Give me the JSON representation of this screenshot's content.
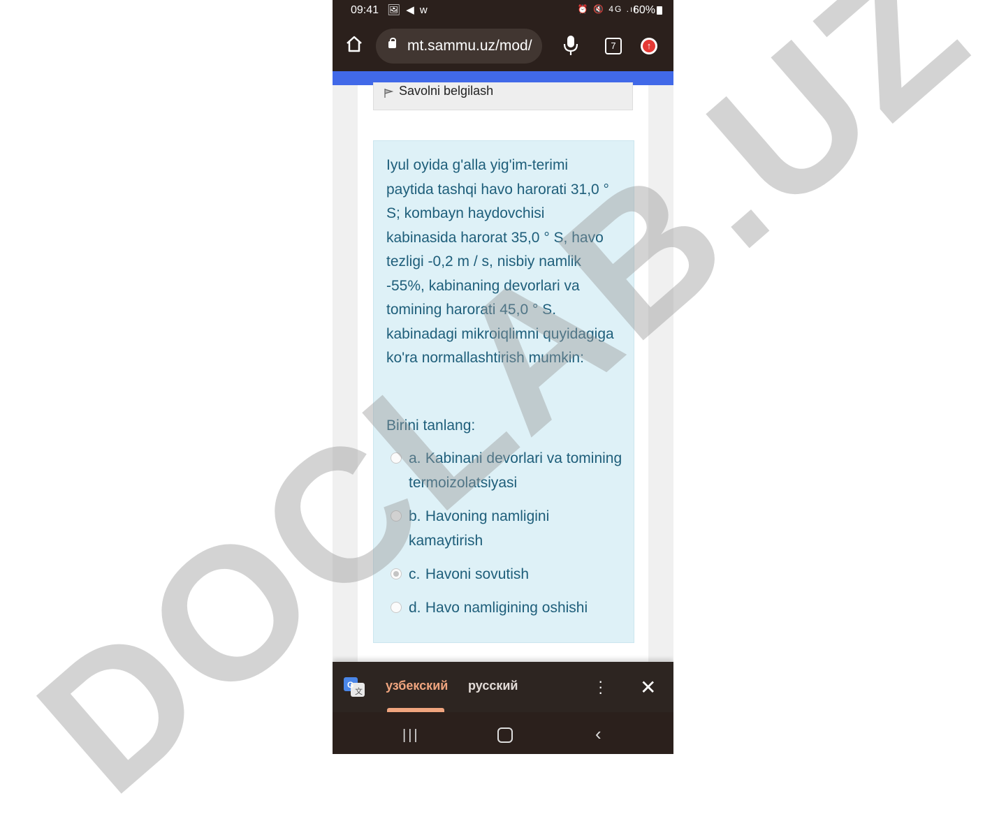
{
  "statusbar": {
    "time": "09:41",
    "left_icons": "🖼 ◀ w",
    "right_icons": "⏰ 🔇 4G .ıl",
    "battery": "60%"
  },
  "browser": {
    "url": "mt.sammu.uz/mod/",
    "tab_count": "7"
  },
  "page": {
    "flag_label": "Savolni belgilash",
    "question": "Iyul oyida g'alla yig'im-terimi paytida tashqi havo harorati 31,0 ° S; kombayn haydovchisi kabinasida harorat 35,0 ° S, havo tezligi -0,2 m / s, nisbiy namlik -55%, kabinaning devorlari va tomining harorati 45,0 ° S. kabinadagi mikroiqlimni quyidagiga ko'ra normallashtirish mumkin:",
    "prompt": "Birini tanlang:",
    "options": [
      {
        "letter": "a.",
        "text": "Kabinani devorlari va tomining termoizolatsiyasi",
        "selected": false
      },
      {
        "letter": "b.",
        "text": "Havoning namligini kamaytirish",
        "selected": false
      },
      {
        "letter": "c.",
        "text": "Havoni sovutish",
        "selected": true
      },
      {
        "letter": "d.",
        "text": "Havo namligining oshishi",
        "selected": false
      }
    ]
  },
  "translate": {
    "lang_active": "узбекский",
    "lang_other": "русский"
  },
  "watermark": "DOCLAB.UZ",
  "colors": {
    "accent_progress": "#4169e8",
    "question_bg": "#def1f7",
    "question_text": "#1e5e7a",
    "translate_accent": "#f0a57f"
  }
}
